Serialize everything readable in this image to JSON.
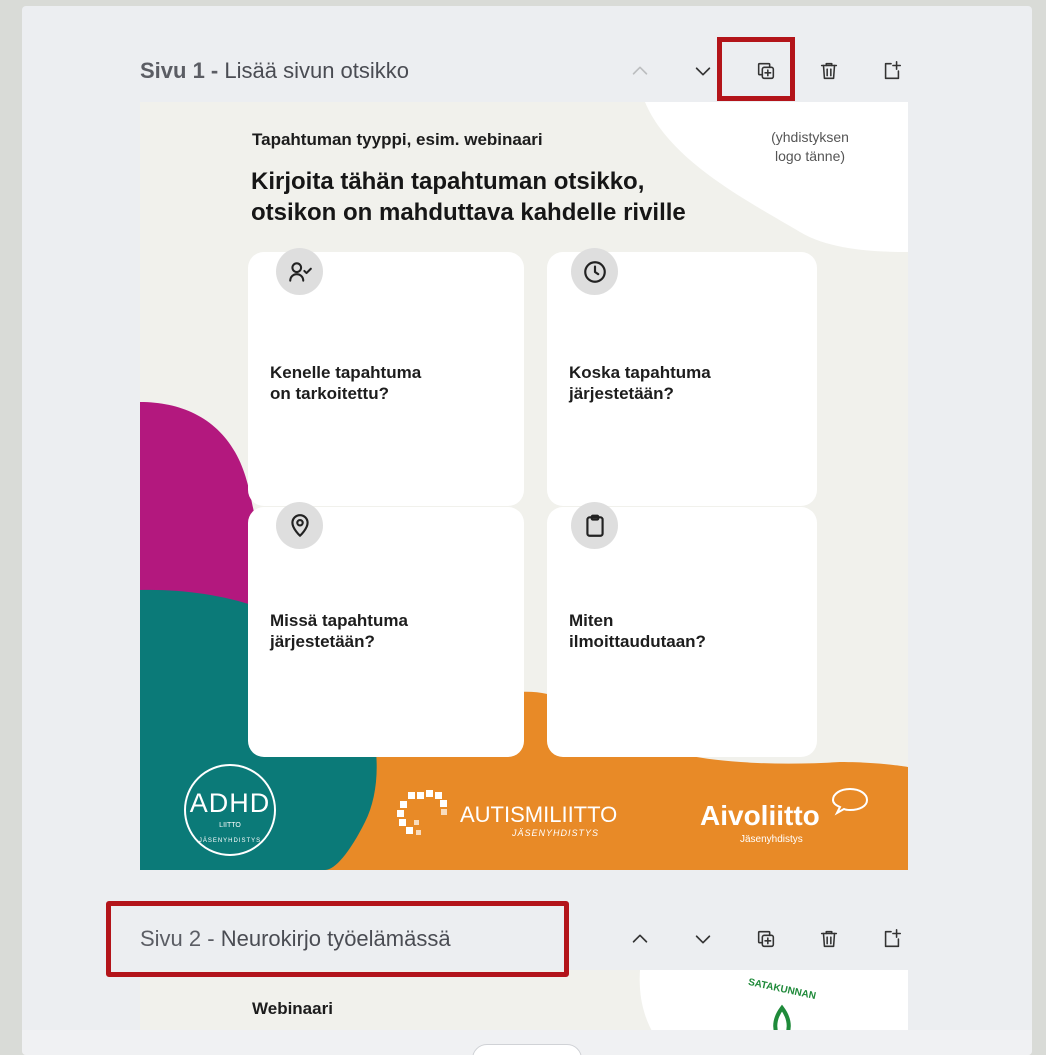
{
  "page1": {
    "number_label": "Sivu 1 -",
    "title": "Lisää sivun otsikko",
    "poster": {
      "event_type": "Tapahtuman tyyppi, esim. webinaari",
      "logo_placeholder": "(yhdistyksen\nlogo tänne)",
      "headline": "Kirjoita tähän tapahtuman otsikko,\notsikon on mahduttava kahdelle riville",
      "cards": [
        {
          "icon": "user-check-icon",
          "label": "Kenelle tapahtuma\non tarkoitettu?"
        },
        {
          "icon": "clock-icon",
          "label": "Koska tapahtuma\njärjestetään?"
        },
        {
          "icon": "map-pin-icon",
          "label": "Missä tapahtuma\njärjestetään?"
        },
        {
          "icon": "clipboard-icon",
          "label": "Miten\nilmoittaudutaan?"
        }
      ],
      "logos": {
        "adhd": "ADHD",
        "adhd_sub": "LIITTO",
        "adhd_ring": "JÄSENYHDISTYS",
        "autismi": "AUTISMILIITTO",
        "autismi_sub": "JÄSENYHDISTYS",
        "aivo": "Aivoliitto",
        "aivo_sub": "Jäsenyhdistys"
      }
    }
  },
  "page2": {
    "number_label": "Sivu 2 -",
    "title": "Neurokirjo työelämässä",
    "poster": {
      "event_type": "Webinaari",
      "logo_text": "SATAKUNNAN"
    }
  },
  "colors": {
    "magenta": "#b3187e",
    "teal": "#0b7a78",
    "orange": "#e88a27",
    "highlight": "#b3141a"
  }
}
